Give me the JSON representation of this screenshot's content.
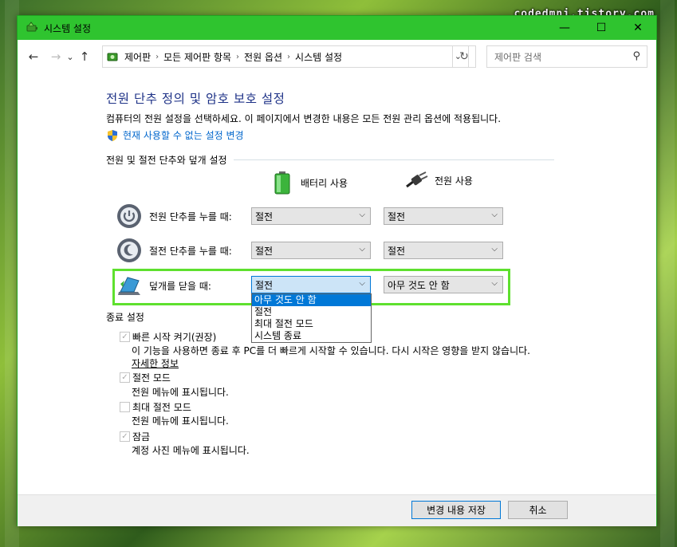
{
  "watermark": "codedmni.tistory.com",
  "window": {
    "title": "시스템 설정",
    "title_color": "#2fc42f"
  },
  "caption": {
    "minimize": "—",
    "maximize": "☐",
    "close": "✕"
  },
  "nav": {
    "back": "←",
    "forward": "→",
    "recent": "⌄",
    "up": "↑"
  },
  "address": {
    "crumbs": [
      "제어판",
      "모든 제어판 항목",
      "전원 옵션",
      "시스템 설정"
    ],
    "sep": "›",
    "dropdown": "⌄",
    "refresh": "↻"
  },
  "search": {
    "placeholder": "제어판 검색",
    "icon": "⚲"
  },
  "page": {
    "title": "전원 단추 정의 및 암호 보호 설정",
    "description": "컴퓨터의 전원 설정을 선택하세요. 이 페이지에서 변경한 내용은 모든 전원 관리 옵션에 적용됩니다.",
    "change_link": "현재 사용할 수 없는 설정 변경"
  },
  "power_section": {
    "heading": "전원 및 절전 단추와 덮개 설정",
    "col_battery": "배터리 사용",
    "col_plugged": "전원 사용",
    "rows": [
      {
        "label": "전원 단추를 누를 때:",
        "battery": "절전",
        "plugged": "절전"
      },
      {
        "label": "절전 단추를 누를 때:",
        "battery": "절전",
        "plugged": "절전"
      },
      {
        "label": "덮개를 닫을 때:",
        "battery": "절전",
        "plugged": "아무 것도 안 함"
      }
    ],
    "dropdown_options": [
      "아무 것도 안 함",
      "절전",
      "최대 절전 모드",
      "시스템 종료"
    ],
    "dropdown_selected_index": 0,
    "arrow": "⌵"
  },
  "shutdown_section": {
    "heading": "종료 설정",
    "items": [
      {
        "label": "빠른 시작 켜기(권장)",
        "checked": true,
        "desc": "이 기능을 사용하면 종료 후 PC를 더 빠르게 시작할 수 있습니다. 다시 시작은 영향을 받지 않습니다.",
        "link": "자세한 정보"
      },
      {
        "label": "절전 모드",
        "checked": true,
        "desc": "전원 메뉴에 표시됩니다."
      },
      {
        "label": "최대 절전 모드",
        "checked": false,
        "desc": "전원 메뉴에 표시됩니다."
      },
      {
        "label": "잠금",
        "checked": true,
        "desc": "계정 사진 메뉴에 표시됩니다."
      }
    ],
    "check_glyph": "✓"
  },
  "footer": {
    "save": "변경 내용 저장",
    "cancel": "취소"
  },
  "colors": {
    "accent": "#0078d7",
    "title": "#1e3287",
    "link": "#0066cc",
    "highlight": "#5ee02e"
  }
}
